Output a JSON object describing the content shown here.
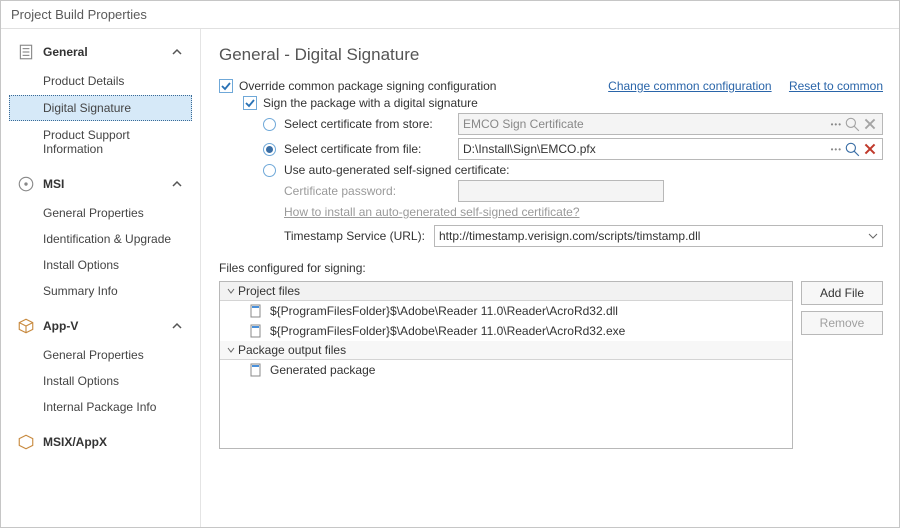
{
  "window": {
    "title": "Project Build Properties"
  },
  "sidebar": {
    "groups": [
      {
        "label": "General",
        "items": [
          {
            "label": "Product Details"
          },
          {
            "label": "Digital Signature"
          },
          {
            "label": "Product Support Information"
          }
        ]
      },
      {
        "label": "MSI",
        "items": [
          {
            "label": "General Properties"
          },
          {
            "label": "Identification & Upgrade"
          },
          {
            "label": "Install Options"
          },
          {
            "label": "Summary Info"
          }
        ]
      },
      {
        "label": "App-V",
        "items": [
          {
            "label": "General Properties"
          },
          {
            "label": "Install Options"
          },
          {
            "label": "Internal Package Info"
          }
        ]
      },
      {
        "label": "MSIX/AppX",
        "items": []
      }
    ]
  },
  "page": {
    "title": "General - Digital Signature",
    "override": {
      "label": "Override common package signing configuration"
    },
    "link_change": "Change common configuration",
    "link_reset": "Reset to common",
    "sign": {
      "label": "Sign the package with a digital signature"
    },
    "opt_store": {
      "label": "Select certificate from store:",
      "value": "EMCO Sign Certificate"
    },
    "opt_file": {
      "label": "Select certificate from file:",
      "value": "D:\\Install\\Sign\\EMCO.pfx"
    },
    "opt_auto": {
      "label": "Use auto-generated self-signed certificate:"
    },
    "cert_pw": {
      "label": "Certificate password:"
    },
    "howto_link": "How to install an auto-generated self-signed certificate?",
    "ts_label": "Timestamp Service (URL):",
    "ts_value": "http://timestamp.verisign.com/scripts/timstamp.dll",
    "files_label": "Files configured for signing:",
    "tree": {
      "group1": "Project files",
      "row1": "${ProgramFilesFolder}$\\Adobe\\Reader 11.0\\Reader\\AcroRd32.dll",
      "row2": "${ProgramFilesFolder}$\\Adobe\\Reader 11.0\\Reader\\AcroRd32.exe",
      "group2": "Package output files",
      "row3": "Generated package"
    },
    "btn_add": "Add File",
    "btn_remove": "Remove"
  }
}
